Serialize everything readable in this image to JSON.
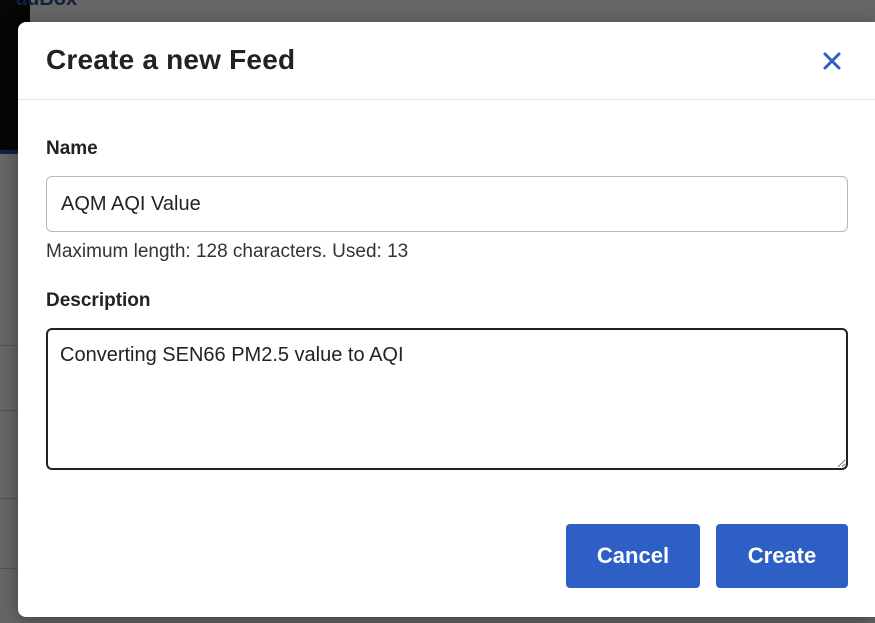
{
  "background": {
    "top_text": "adBox"
  },
  "modal": {
    "title": "Create a new Feed",
    "close_icon": "close-icon",
    "name_field": {
      "label": "Name",
      "value": "AQM AQI Value",
      "helper": "Maximum length: 128 characters. Used: 13"
    },
    "description_field": {
      "label": "Description",
      "value": "Converting SEN66 PM2.5 value to AQI"
    },
    "buttons": {
      "cancel_label": "Cancel",
      "create_label": "Create"
    }
  },
  "colors": {
    "accent": "#2d5fc4",
    "overlay": "rgba(0,0,0,0.6)"
  }
}
